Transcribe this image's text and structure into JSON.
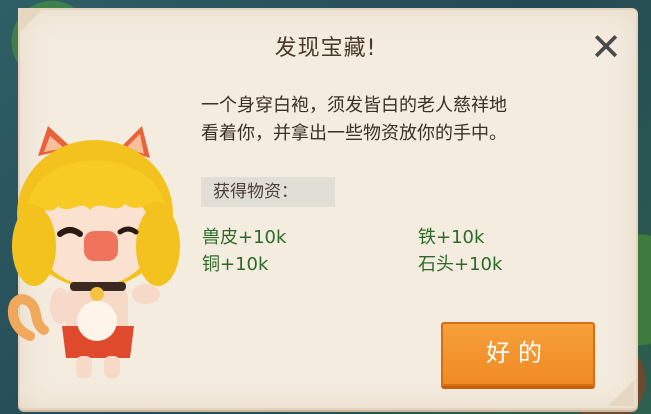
{
  "dialog": {
    "title": "发现宝藏!",
    "close_icon": "close-icon",
    "description_line1": "一个身穿白袍，须发皆白的老人慈祥地",
    "description_line2": "看着你，并拿出一些物资放你的手中。",
    "section_label": "获得物资：",
    "rewards": [
      {
        "text": "兽皮+10k"
      },
      {
        "text": "铁+10k"
      },
      {
        "text": "铜+10k"
      },
      {
        "text": "石头+10k"
      }
    ],
    "ok_button": "好的"
  },
  "colors": {
    "panel": "#f4ecdf",
    "reward_text": "#2d6a2a",
    "button_orange": "#f08a24"
  },
  "character": {
    "icon": "cat-character-icon"
  }
}
